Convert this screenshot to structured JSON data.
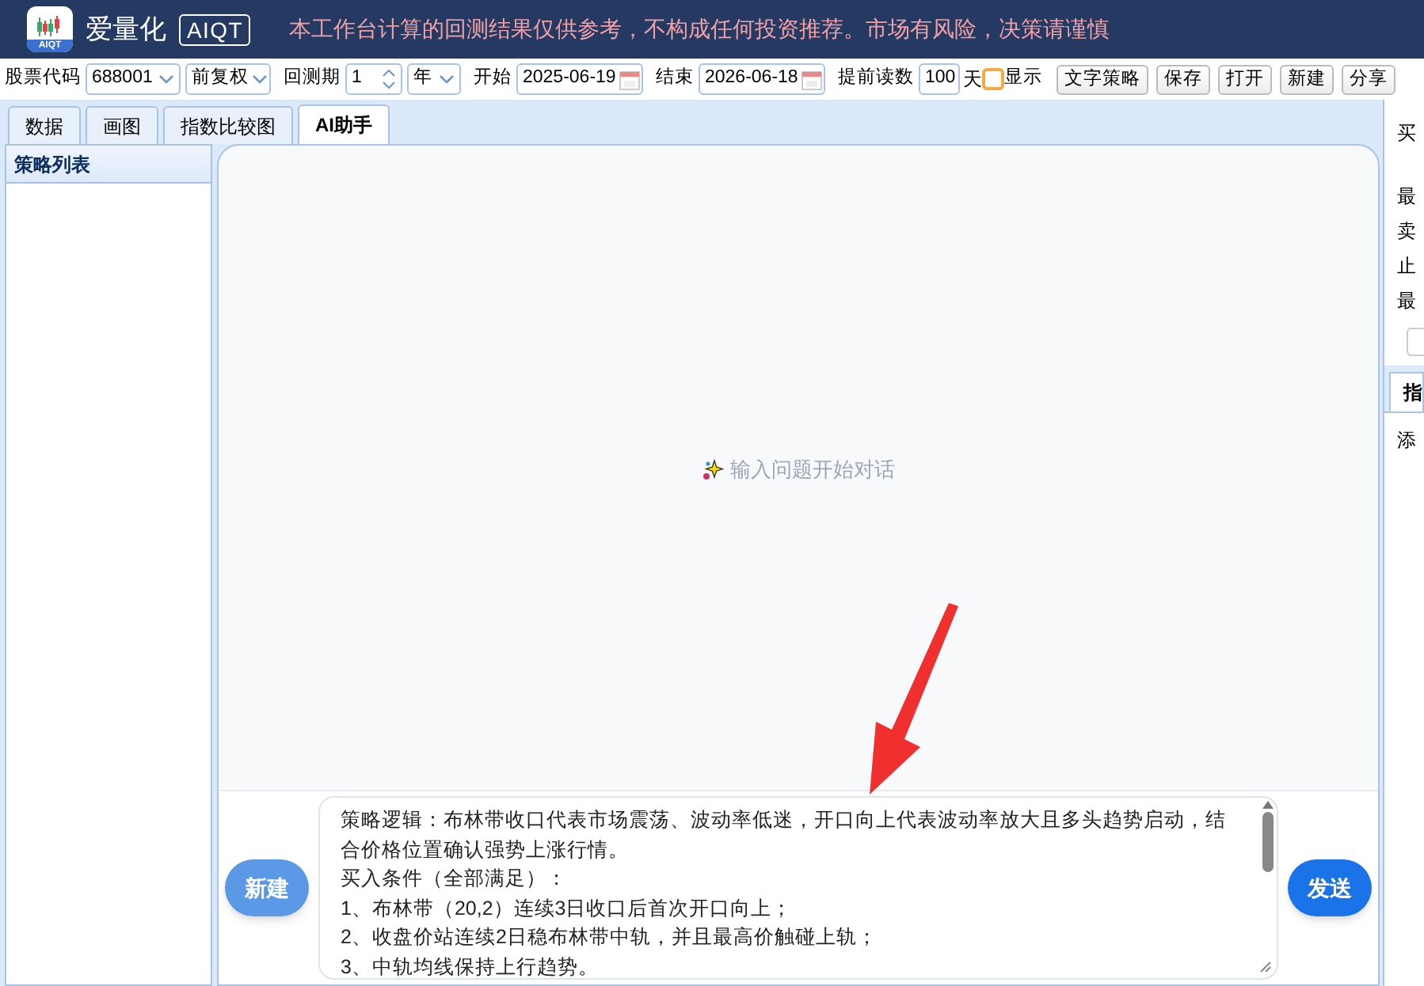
{
  "header": {
    "app_name": "爱量化",
    "badge": "AIQT",
    "logo_text": "AIQT",
    "notice": "本工作台计算的回测结果仅供参考，不构成任何投资推荐。市场有风险，决策请谨慎"
  },
  "toolbar": {
    "stock_label": "股票代码",
    "stock_value": "688001",
    "adjust_value": "前复权",
    "period_label": "回测期",
    "period_value": "1",
    "period_unit": "年",
    "start_label": "开始",
    "start_value": "2025-06-19",
    "end_label": "结束",
    "end_value": "2026-06-18",
    "preload_label": "提前读数",
    "preload_value": "100",
    "preload_unit": "天",
    "show_label": "显示",
    "show_checked": false,
    "buttons": [
      "文字策略",
      "保存",
      "打开",
      "新建",
      "分享"
    ]
  },
  "tabs": [
    {
      "label": "数据",
      "selected": false
    },
    {
      "label": "画图",
      "selected": false
    },
    {
      "label": "指数比较图",
      "selected": false
    },
    {
      "label": "AI助手",
      "selected": true
    }
  ],
  "sidebar": {
    "title": "策略列表"
  },
  "chat": {
    "empty_hint": "输入问题开始对话",
    "new_button": "新建",
    "send_button": "发送",
    "input_lines": [
      "策略逻辑：布林带收口代表市场震荡、波动率低迷，开口向上代表波动率放大且多头趋势启动，结合价格位置确认强势上涨行情。",
      "买入条件（全部满足）：",
      "1、布林带（20,2）连续3日收口后首次开口向上；",
      "2、收盘价站连续2日稳布林带中轨，并且最高价触碰上轨；",
      "3、中轨均线保持上行趋势。"
    ]
  },
  "right_panel": {
    "labels": [
      "买",
      "最",
      "卖",
      "止",
      "最"
    ],
    "tab": "指",
    "footer_label": "添"
  }
}
